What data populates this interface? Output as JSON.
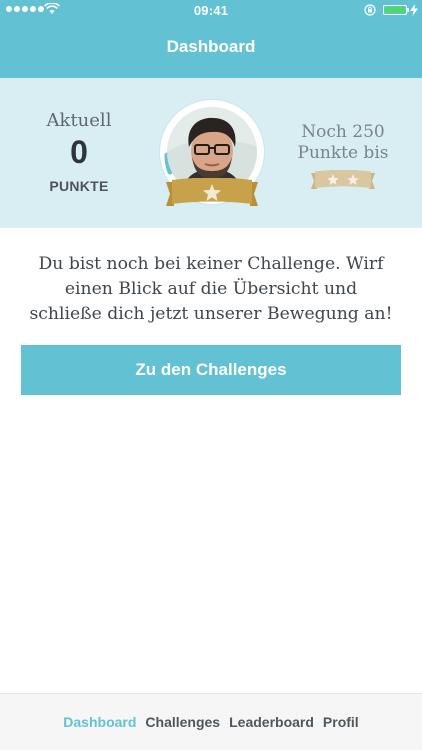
{
  "status_bar": {
    "time": "09:41",
    "signal_icon": "signal-dots-icon",
    "wifi_icon": "wifi-icon",
    "lock_icon": "orientation-lock-icon",
    "battery_icon": "battery-icon",
    "charging_icon": "bolt-icon"
  },
  "header": {
    "title": "Dashboard"
  },
  "points": {
    "current_label": "Aktuell",
    "current_value": "0",
    "unit": "PUNKTE",
    "next_label_line1": "Noch 250",
    "next_label_line2": "Punkte bis"
  },
  "badges": {
    "current_level_stars": 1,
    "next_level_stars": 2,
    "badge_icon": "star-ribbon-icon"
  },
  "message": {
    "line1": "Du bist noch bei keiner Challenge. Wirf",
    "line2": "einen Blick auf die Übersicht und",
    "line3": "schließe dich jetzt unserer Bewegung an!"
  },
  "cta": {
    "label": "Zu den Challenges"
  },
  "tabs": [
    {
      "label": "Dashboard",
      "active": true
    },
    {
      "label": "Challenges",
      "active": false
    },
    {
      "label": "Leaderboard",
      "active": false
    },
    {
      "label": "Profil",
      "active": false
    }
  ],
  "colors": {
    "accent": "#62c2d3",
    "summary_bg": "#d9eef3",
    "badge_gold": "#c8a24a",
    "badge_tan": "#d9c79f"
  }
}
